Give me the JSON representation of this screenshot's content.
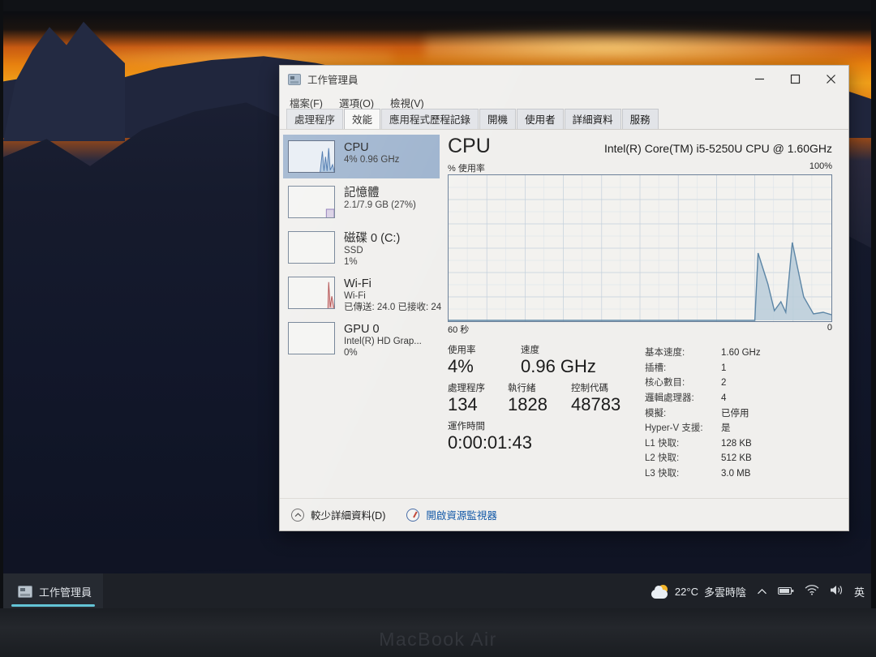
{
  "device": {
    "label": "MacBook Air"
  },
  "taskbar": {
    "app": {
      "label": "工作管理員",
      "icon": "task-manager-icon"
    },
    "tray": {
      "weather_temp": "22°C",
      "weather_desc": "多雲時陰",
      "chevron": "⌃",
      "ime": "英",
      "icons": [
        "battery-icon",
        "wifi-icon",
        "volume-icon"
      ]
    }
  },
  "window": {
    "title": "工作管理員",
    "controls": {
      "minimize": "minimize-button",
      "maximize": "maximize-button",
      "close": "close-button"
    },
    "menu": [
      "檔案(F)",
      "選項(O)",
      "檢視(V)"
    ],
    "tabs": [
      {
        "label": "處理程序",
        "active": false
      },
      {
        "label": "效能",
        "active": true
      },
      {
        "label": "應用程式歷程記錄",
        "active": false
      },
      {
        "label": "開機",
        "active": false
      },
      {
        "label": "使用者",
        "active": false
      },
      {
        "label": "詳細資料",
        "active": false
      },
      {
        "label": "服務",
        "active": false
      }
    ]
  },
  "sidebar": {
    "items": [
      {
        "name": "CPU",
        "sub1": "4% 0.96 GHz",
        "sub2": "",
        "selected": true
      },
      {
        "name": "記憶體",
        "sub1": "2.1/7.9 GB (27%)",
        "sub2": "",
        "selected": false
      },
      {
        "name": "磁碟 0 (C:)",
        "sub1": "SSD",
        "sub2": "1%",
        "selected": false
      },
      {
        "name": "Wi-Fi",
        "sub1": "Wi-Fi",
        "sub2": "已傳送: 24.0 已接收: 24",
        "selected": false
      },
      {
        "name": "GPU 0",
        "sub1": "Intel(R) HD Grap...",
        "sub2": "0%",
        "selected": false
      }
    ]
  },
  "main": {
    "title": "CPU",
    "model": "Intel(R) Core(TM) i5-5250U CPU @ 1.60GHz",
    "chart_axis_label": "% 使用率",
    "chart_max": "100%",
    "chart_time_left": "60 秒",
    "chart_time_right": "0",
    "stats_row1": [
      {
        "label": "使用率",
        "value": "4%"
      },
      {
        "label": "速度",
        "value": "0.96 GHz"
      }
    ],
    "stats_row2": [
      {
        "label": "處理程序",
        "value": "134"
      },
      {
        "label": "執行緒",
        "value": "1828"
      },
      {
        "label": "控制代碼",
        "value": "48783"
      }
    ],
    "stats_row3": [
      {
        "label": "運作時間",
        "value": "0:00:01:43"
      }
    ],
    "details": [
      {
        "key": "基本速度:",
        "value": "1.60 GHz"
      },
      {
        "key": "插槽:",
        "value": "1"
      },
      {
        "key": "核心數目:",
        "value": "2"
      },
      {
        "key": "邏輯處理器:",
        "value": "4"
      },
      {
        "key": "模擬:",
        "value": "已停用"
      },
      {
        "key": "Hyper-V 支援:",
        "value": "是"
      },
      {
        "key": "L1 快取:",
        "value": "128 KB"
      },
      {
        "key": "L2 快取:",
        "value": "512 KB"
      },
      {
        "key": "L3 快取:",
        "value": "3.0 MB"
      }
    ]
  },
  "footer": {
    "fewer_details": "較少詳細資料(D)",
    "resource_monitor": "開啟資源監視器"
  },
  "chart_data": {
    "type": "area",
    "title": "CPU 使用率",
    "xlabel": "60 秒",
    "ylabel": "% 使用率",
    "ylim": [
      0,
      100
    ],
    "xlim": [
      0,
      60
    ],
    "grid": true,
    "accent_color": "#6d8fae",
    "fill_color": "#bdd0dd",
    "x": [
      0,
      2,
      4,
      6,
      8,
      10,
      12,
      14,
      16,
      18,
      20,
      22,
      24,
      26,
      28,
      30,
      32,
      34,
      36,
      38,
      40,
      42,
      44,
      46,
      48,
      50,
      52,
      54,
      56,
      58,
      60
    ],
    "values": [
      0,
      0,
      0,
      0,
      0,
      0,
      0,
      0,
      0,
      0,
      0,
      0,
      0,
      0,
      0,
      0,
      0,
      0,
      0,
      0,
      0,
      0,
      0,
      0,
      0,
      0,
      0,
      0,
      0,
      0,
      0
    ],
    "recent_window": {
      "note": "two spikes at right edge of 60s window",
      "points": [
        {
          "t": 48.0,
          "v": 0
        },
        {
          "t": 48.5,
          "v": 46
        },
        {
          "t": 50.0,
          "v": 22
        },
        {
          "t": 51.5,
          "v": 5
        },
        {
          "t": 52.5,
          "v": 12
        },
        {
          "t": 53.5,
          "v": 4
        },
        {
          "t": 54.5,
          "v": 55
        },
        {
          "t": 56.5,
          "v": 18
        },
        {
          "t": 58.5,
          "v": 4
        },
        {
          "t": 60.0,
          "v": 4
        }
      ]
    }
  }
}
